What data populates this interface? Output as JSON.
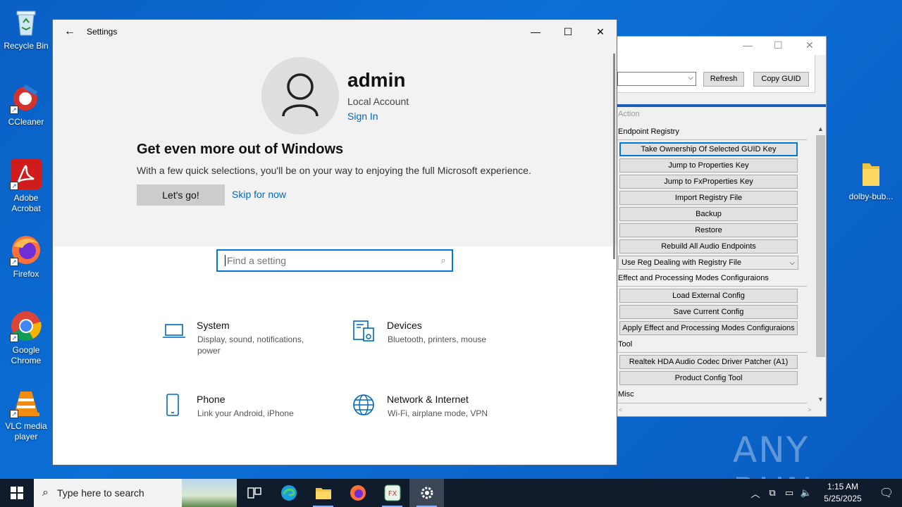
{
  "desktop": {
    "icons": [
      {
        "label": "Recycle Bin"
      },
      {
        "label": "CCleaner"
      },
      {
        "label": "Adobe Acrobat"
      },
      {
        "label": "Firefox"
      },
      {
        "label": "Google Chrome"
      },
      {
        "label": "VLC media player"
      }
    ],
    "folder_label": "dolby-bub...",
    "watermark": "ANY RUN"
  },
  "settings": {
    "title": "Settings",
    "user": {
      "name": "admin",
      "account": "Local Account",
      "sign_in": "Sign In"
    },
    "promo": {
      "title": "Get even more out of Windows",
      "description": "With a few quick selections, you'll be on your way to enjoying the full Microsoft experience.",
      "primary_button": "Let's go!",
      "secondary_link": "Skip for now"
    },
    "search_placeholder": "Find a setting",
    "categories": [
      {
        "name": "System",
        "desc": "Display, sound, notifications, power",
        "icon": "laptop-icon"
      },
      {
        "name": "Devices",
        "desc": "Bluetooth, printers, mouse",
        "icon": "devices-icon"
      },
      {
        "name": "Phone",
        "desc": "Link your Android, iPhone",
        "icon": "phone-icon"
      },
      {
        "name": "Network & Internet",
        "desc": "Wi-Fi, airplane mode, VPN",
        "icon": "globe-icon"
      }
    ]
  },
  "tool": {
    "refresh": "Refresh",
    "copy_guid": "Copy GUID",
    "action_header": "Action",
    "sections": {
      "endpoint": "Endpoint Registry",
      "effect": "Effect and Processing Modes Configuraions",
      "tool": "Tool",
      "misc": "Misc"
    },
    "endpoint_buttons": [
      "Take Ownership Of Selected GUID Key",
      "Jump to Properties Key",
      "Jump to FxProperties Key",
      "Import Registry File",
      "Backup",
      "Restore",
      "Rebuild All Audio Endpoints"
    ],
    "reg_dropdown": "Use Reg Dealing with Registry File",
    "effect_buttons": [
      "Load External Config",
      "Save Current Config",
      "Apply Effect and Processing Modes Configuraions"
    ],
    "tool_buttons": [
      "Realtek HDA Audio Codec Driver Patcher (A1)",
      "Product Config Tool"
    ]
  },
  "taskbar": {
    "search_placeholder": "Type here to search",
    "time": "1:15 AM",
    "date": "5/25/2025"
  }
}
